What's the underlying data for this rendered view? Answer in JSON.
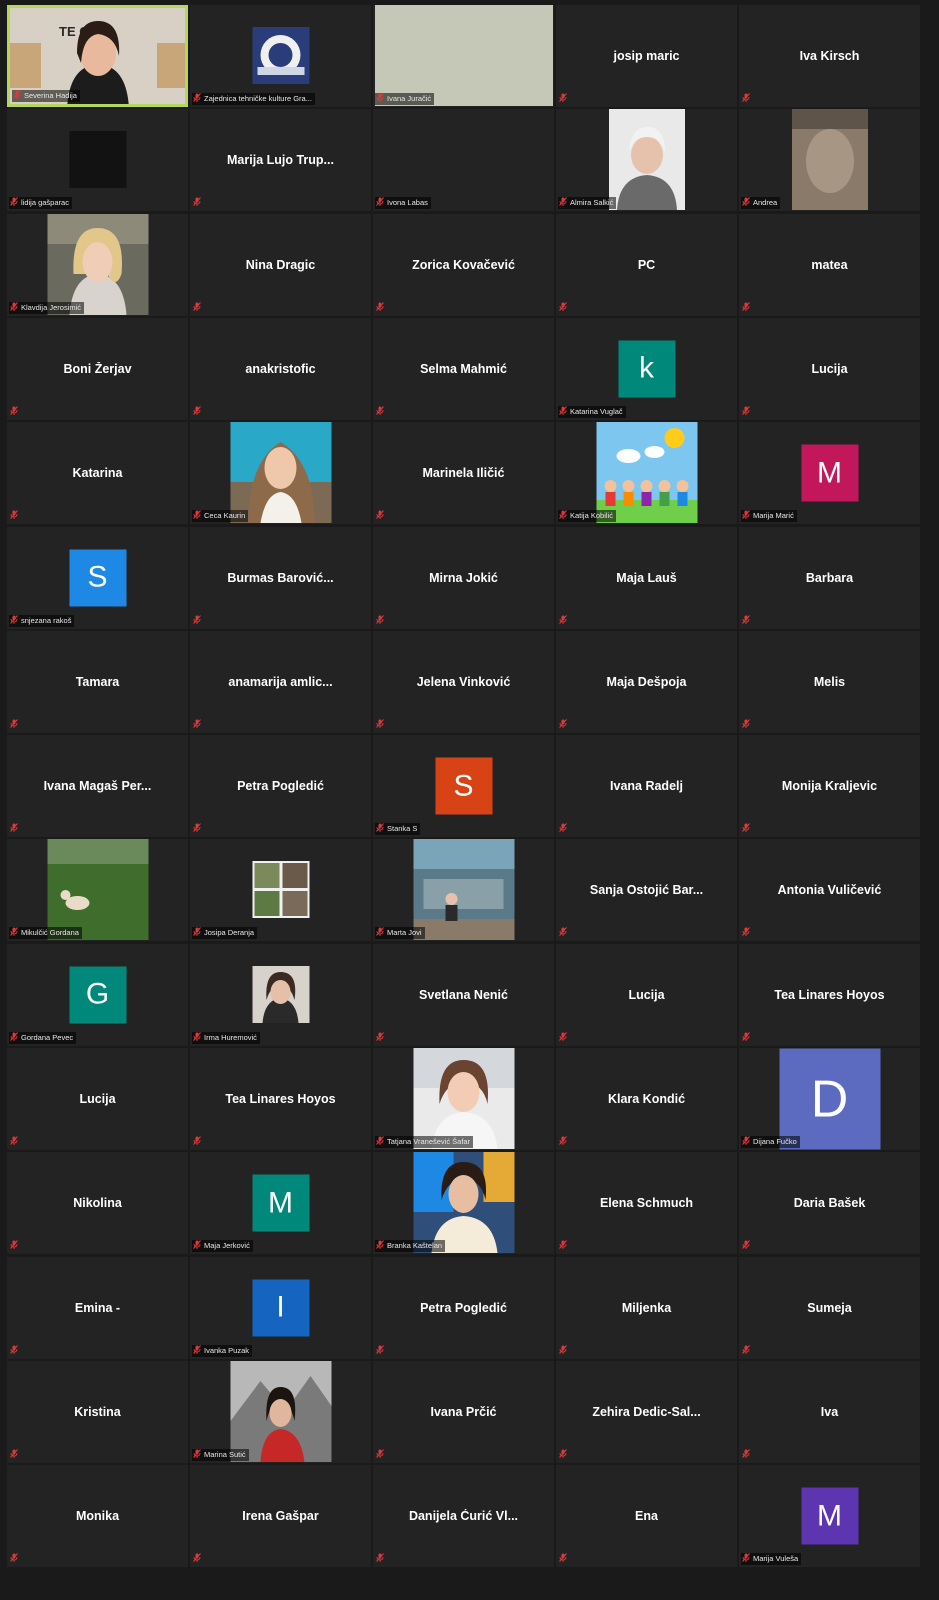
{
  "colors": {
    "background": "#1a1a1a",
    "tile": "#232323",
    "active_border": "#b6d85a",
    "mic_muted": "#e0393b"
  },
  "tiles": [
    {
      "type": "video",
      "label": "Severina Hadija",
      "active": true,
      "video": "speaker"
    },
    {
      "type": "video",
      "label": "Zajednica tehničke kulture Gra...",
      "video": "logo"
    },
    {
      "type": "video",
      "label": "Ivana Juračić",
      "video": "blank"
    },
    {
      "type": "name",
      "name": "josip maric"
    },
    {
      "type": "name",
      "name": "Iva Kirsch"
    },
    {
      "type": "video",
      "label": "lidija gašparac",
      "video": "dark"
    },
    {
      "type": "name",
      "name": "Marija  Lujo  Trup..."
    },
    {
      "type": "blank",
      "label": "Ivona Labas"
    },
    {
      "type": "video",
      "label": "Almira Salkić",
      "video": "portrait-light"
    },
    {
      "type": "video",
      "label": "Andrea",
      "video": "blur"
    },
    {
      "type": "video",
      "label": "Klavdija Jerosimić",
      "video": "portrait-blonde"
    },
    {
      "type": "name",
      "name": "Nina Dragic"
    },
    {
      "type": "name",
      "name": "Zorica Kovačević"
    },
    {
      "type": "name",
      "name": "PC"
    },
    {
      "type": "name",
      "name": "matea"
    },
    {
      "type": "name",
      "name": "Boni Žerjav"
    },
    {
      "type": "name",
      "name": "anakristofic"
    },
    {
      "type": "name",
      "name": "Selma Mahmić"
    },
    {
      "type": "avatar",
      "letter": "k",
      "color": "#00897b",
      "label": "Katarina Vuglač"
    },
    {
      "type": "name",
      "name": "Lucija"
    },
    {
      "type": "name",
      "name": "Katarina"
    },
    {
      "type": "video",
      "label": "Ceca Kaurin",
      "video": "portrait-pool"
    },
    {
      "type": "name",
      "name": "Marinela Iličić"
    },
    {
      "type": "video",
      "label": "Katija Kobilić",
      "video": "cartoon"
    },
    {
      "type": "avatar",
      "letter": "M",
      "color": "#c2185b",
      "label": "Marija Marić"
    },
    {
      "type": "avatar",
      "letter": "S",
      "color": "#1e88e5",
      "label": "snjezana rakoš"
    },
    {
      "type": "name",
      "name": "Burmas  Barović..."
    },
    {
      "type": "name",
      "name": "Mirna Jokić"
    },
    {
      "type": "name",
      "name": "Maja Lauš"
    },
    {
      "type": "name",
      "name": "Barbara"
    },
    {
      "type": "name",
      "name": "Tamara"
    },
    {
      "type": "name",
      "name": "anamarija  amlic..."
    },
    {
      "type": "name",
      "name": "Jelena Vinković"
    },
    {
      "type": "name",
      "name": "Maja Dešpoja"
    },
    {
      "type": "name",
      "name": "Melis"
    },
    {
      "type": "name",
      "name": "Ivana Magaš Per..."
    },
    {
      "type": "name",
      "name": "Petra Pogledić"
    },
    {
      "type": "avatar",
      "letter": "S",
      "color": "#d84315",
      "label": "Stanka S"
    },
    {
      "type": "name",
      "name": "Ivana Radelj"
    },
    {
      "type": "name",
      "name": "Monija Kraljevic"
    },
    {
      "type": "video",
      "label": "Mikulčić Gordana",
      "video": "grass"
    },
    {
      "type": "video",
      "label": "Josipa Deranja",
      "video": "collage"
    },
    {
      "type": "video",
      "label": "Marta Jovi",
      "video": "street"
    },
    {
      "type": "name",
      "name": "Sanja  Ostojić  Bar..."
    },
    {
      "type": "name",
      "name": "Antonia Vuličević"
    },
    {
      "type": "avatar",
      "letter": "G",
      "color": "#00897b",
      "label": "Gordana Pevec"
    },
    {
      "type": "video",
      "label": "Irma Huremović",
      "video": "portrait-small"
    },
    {
      "type": "name",
      "name": "Svetlana Nenić"
    },
    {
      "type": "name",
      "name": "Lucija"
    },
    {
      "type": "name",
      "name": "Tea Linares Hoyos"
    },
    {
      "type": "name",
      "name": "Lucija"
    },
    {
      "type": "name",
      "name": "Tea Linares Hoyos"
    },
    {
      "type": "video",
      "label": "Tatjana Vranešević Šafar",
      "video": "portrait-smile"
    },
    {
      "type": "name",
      "name": "Klara Kondić"
    },
    {
      "type": "avatar",
      "letter": "D",
      "color": "#5c6bc0",
      "label": "Dijana Fučko",
      "big": true
    },
    {
      "type": "name",
      "name": "Nikolina"
    },
    {
      "type": "avatar",
      "letter": "M",
      "color": "#00897b",
      "label": "Maja Jerković"
    },
    {
      "type": "video",
      "label": "Branka Kaštelan",
      "video": "portrait-mural"
    },
    {
      "type": "name",
      "name": "Elena Schmuch"
    },
    {
      "type": "name",
      "name": "Daria Bašek"
    },
    {
      "type": "name",
      "name": "Emina -"
    },
    {
      "type": "avatar",
      "letter": "I",
      "color": "#1565c0",
      "label": "Ivanka Puzak"
    },
    {
      "type": "name",
      "name": "Petra Pogledić"
    },
    {
      "type": "name",
      "name": "Miljenka"
    },
    {
      "type": "name",
      "name": "Sumeja"
    },
    {
      "type": "name",
      "name": "Kristina"
    },
    {
      "type": "video",
      "label": "Marina Sutić",
      "video": "mountain"
    },
    {
      "type": "name",
      "name": "Ivana Prčić"
    },
    {
      "type": "name",
      "name": "Zehira  Dedic-Sal..."
    },
    {
      "type": "name",
      "name": "Iva"
    },
    {
      "type": "name",
      "name": "Monika"
    },
    {
      "type": "name",
      "name": "Irena Gašpar"
    },
    {
      "type": "name",
      "name": "Danijela  Ćurić  Vl..."
    },
    {
      "type": "name",
      "name": "Ena"
    },
    {
      "type": "avatar",
      "letter": "M",
      "color": "#5e35b1",
      "label": "Marija Vuleša"
    }
  ]
}
